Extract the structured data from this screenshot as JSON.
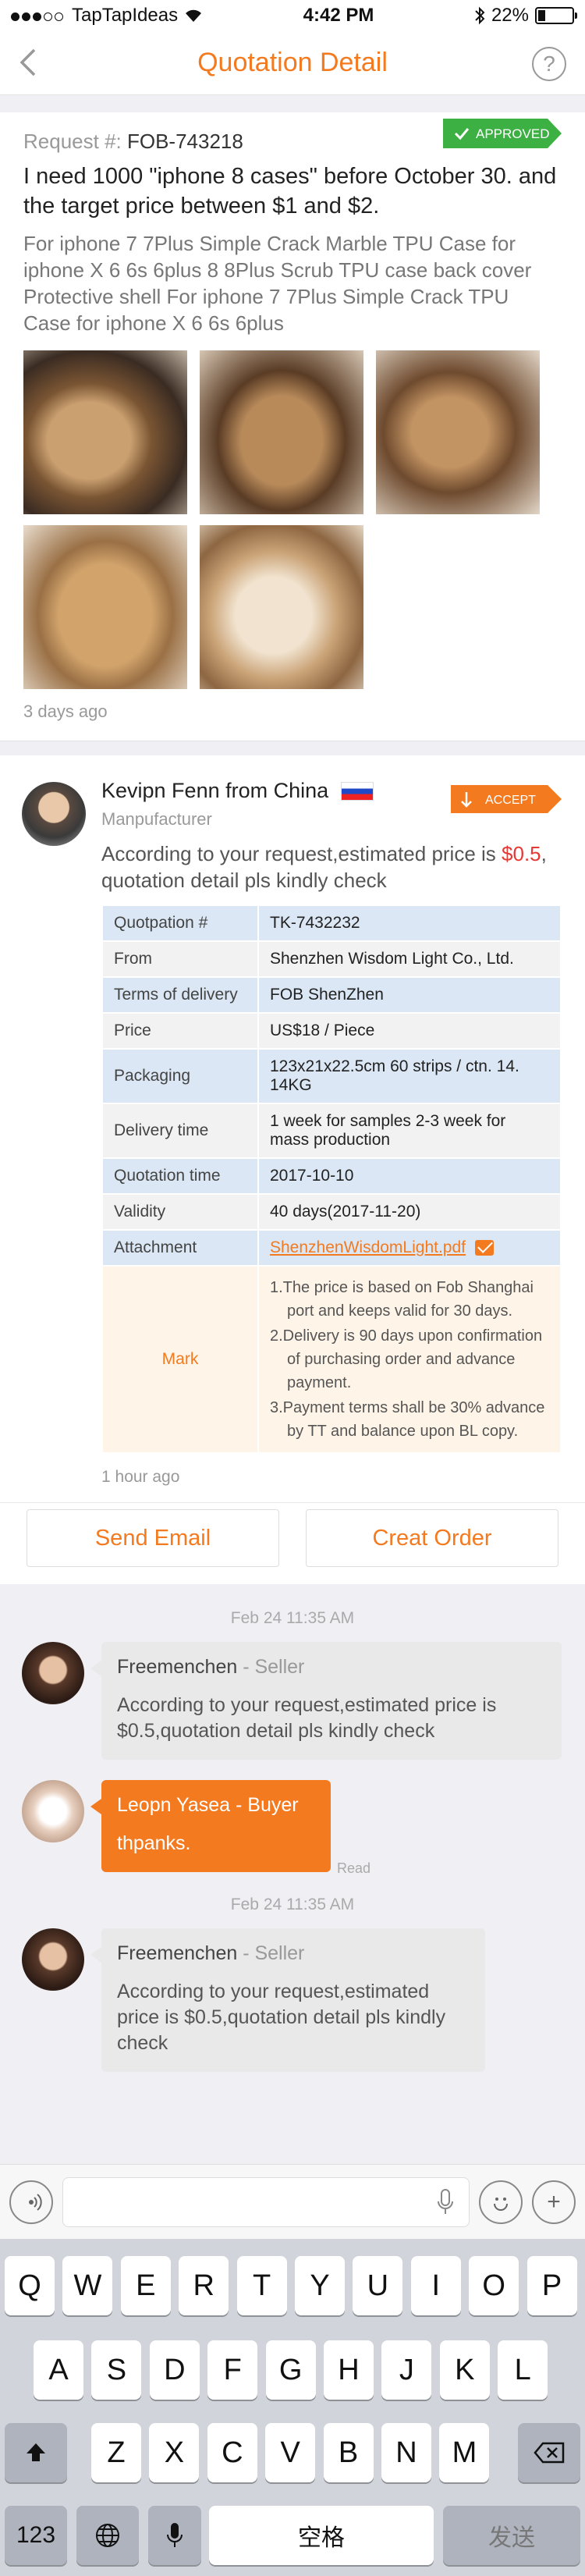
{
  "statusbar": {
    "carrier": "TapTapIdeas",
    "time": "4:42 PM",
    "battery": "22%"
  },
  "nav": {
    "title": "Quotation Detail",
    "help": "?"
  },
  "request": {
    "label": "Request #:",
    "number": "FOB-743218",
    "status": "APPROVED",
    "title": "I need 1000 \"iphone 8 cases\" before October 30. and the target price between $1 and $2.",
    "description": "For iphone 7 7Plus Simple Crack Marble TPU Case for iphone X 6 6s 6plus 8 8Plus Scrub TPU case back cover Protective shell For iphone 7 7Plus Simple Crack TPU Case for iphone X 6 6s 6plus",
    "time": "3 days ago"
  },
  "quote": {
    "seller": "Kevipn Fenn from China",
    "role": "Manpufacturer",
    "status": "ACCEPT",
    "intro": "According to your request,estimated price is ",
    "intro_price": "$0.5",
    "intro_end": ",\nquotation detail pls kindly check",
    "rows": [
      {
        "k": "Quotpation #",
        "v": "TK-7432232"
      },
      {
        "k": "From",
        "v": "Shenzhen Wisdom Light Co., Ltd."
      },
      {
        "k": "Terms of delivery",
        "v": "FOB  ShenZhen"
      },
      {
        "k": "Price",
        "v": "US$18 / Piece"
      },
      {
        "k": "Packaging",
        "v": "123x21x22.5cm 60 strips / ctn. 14. 14KG"
      },
      {
        "k": "Delivery time",
        "v": "1 week for samples 2-3 week for mass production"
      },
      {
        "k": "Quotation time",
        "v": "2017-10-10"
      },
      {
        "k": "Validity",
        "v": "40 days(2017-11-20)"
      }
    ],
    "attachment_label": "Attachment",
    "attachment_file": "ShenzhenWisdomLight.pdf",
    "mark_label": "Mark",
    "marks": [
      "1.The price is based on Fob Shanghai port and keeps valid for 30 days.",
      "2.Delivery is 90 days upon confirmation of purchasing order and advance payment.",
      "3.Payment terms shall be 30% advance by TT and balance upon BL copy."
    ],
    "time": "1 hour ago"
  },
  "actions": {
    "email": "Send Email",
    "order": "Creat Order"
  },
  "chat": {
    "date1": "Feb 24 11:35 AM",
    "m1_name": "Freemenchen",
    "m1_role": " - Seller",
    "m1_text": "According to your request,estimated price is $0.5,quotation detail pls kindly check",
    "m2_name": "Leopn Yasea",
    "m2_role": " - Buyer",
    "m2_text": "thpanks.",
    "m2_read": "Read",
    "date2": "Feb 24 11:35 AM",
    "m3_name": "Freemenchen",
    "m3_role": " - Seller",
    "m3_text": "According to your request,estimated price is $0.5,quotation detail pls kindly check"
  },
  "keyboard": {
    "row1": [
      "Q",
      "W",
      "E",
      "R",
      "T",
      "Y",
      "U",
      "I",
      "O",
      "P"
    ],
    "row2": [
      "A",
      "S",
      "D",
      "F",
      "G",
      "H",
      "J",
      "K",
      "L"
    ],
    "row3": [
      "Z",
      "X",
      "C",
      "V",
      "B",
      "N",
      "M"
    ],
    "num": "123",
    "space": "空格",
    "send": "发送"
  },
  "colors": {
    "accent": "#f47a1f",
    "approved": "#3cb043",
    "price": "#e53935"
  }
}
